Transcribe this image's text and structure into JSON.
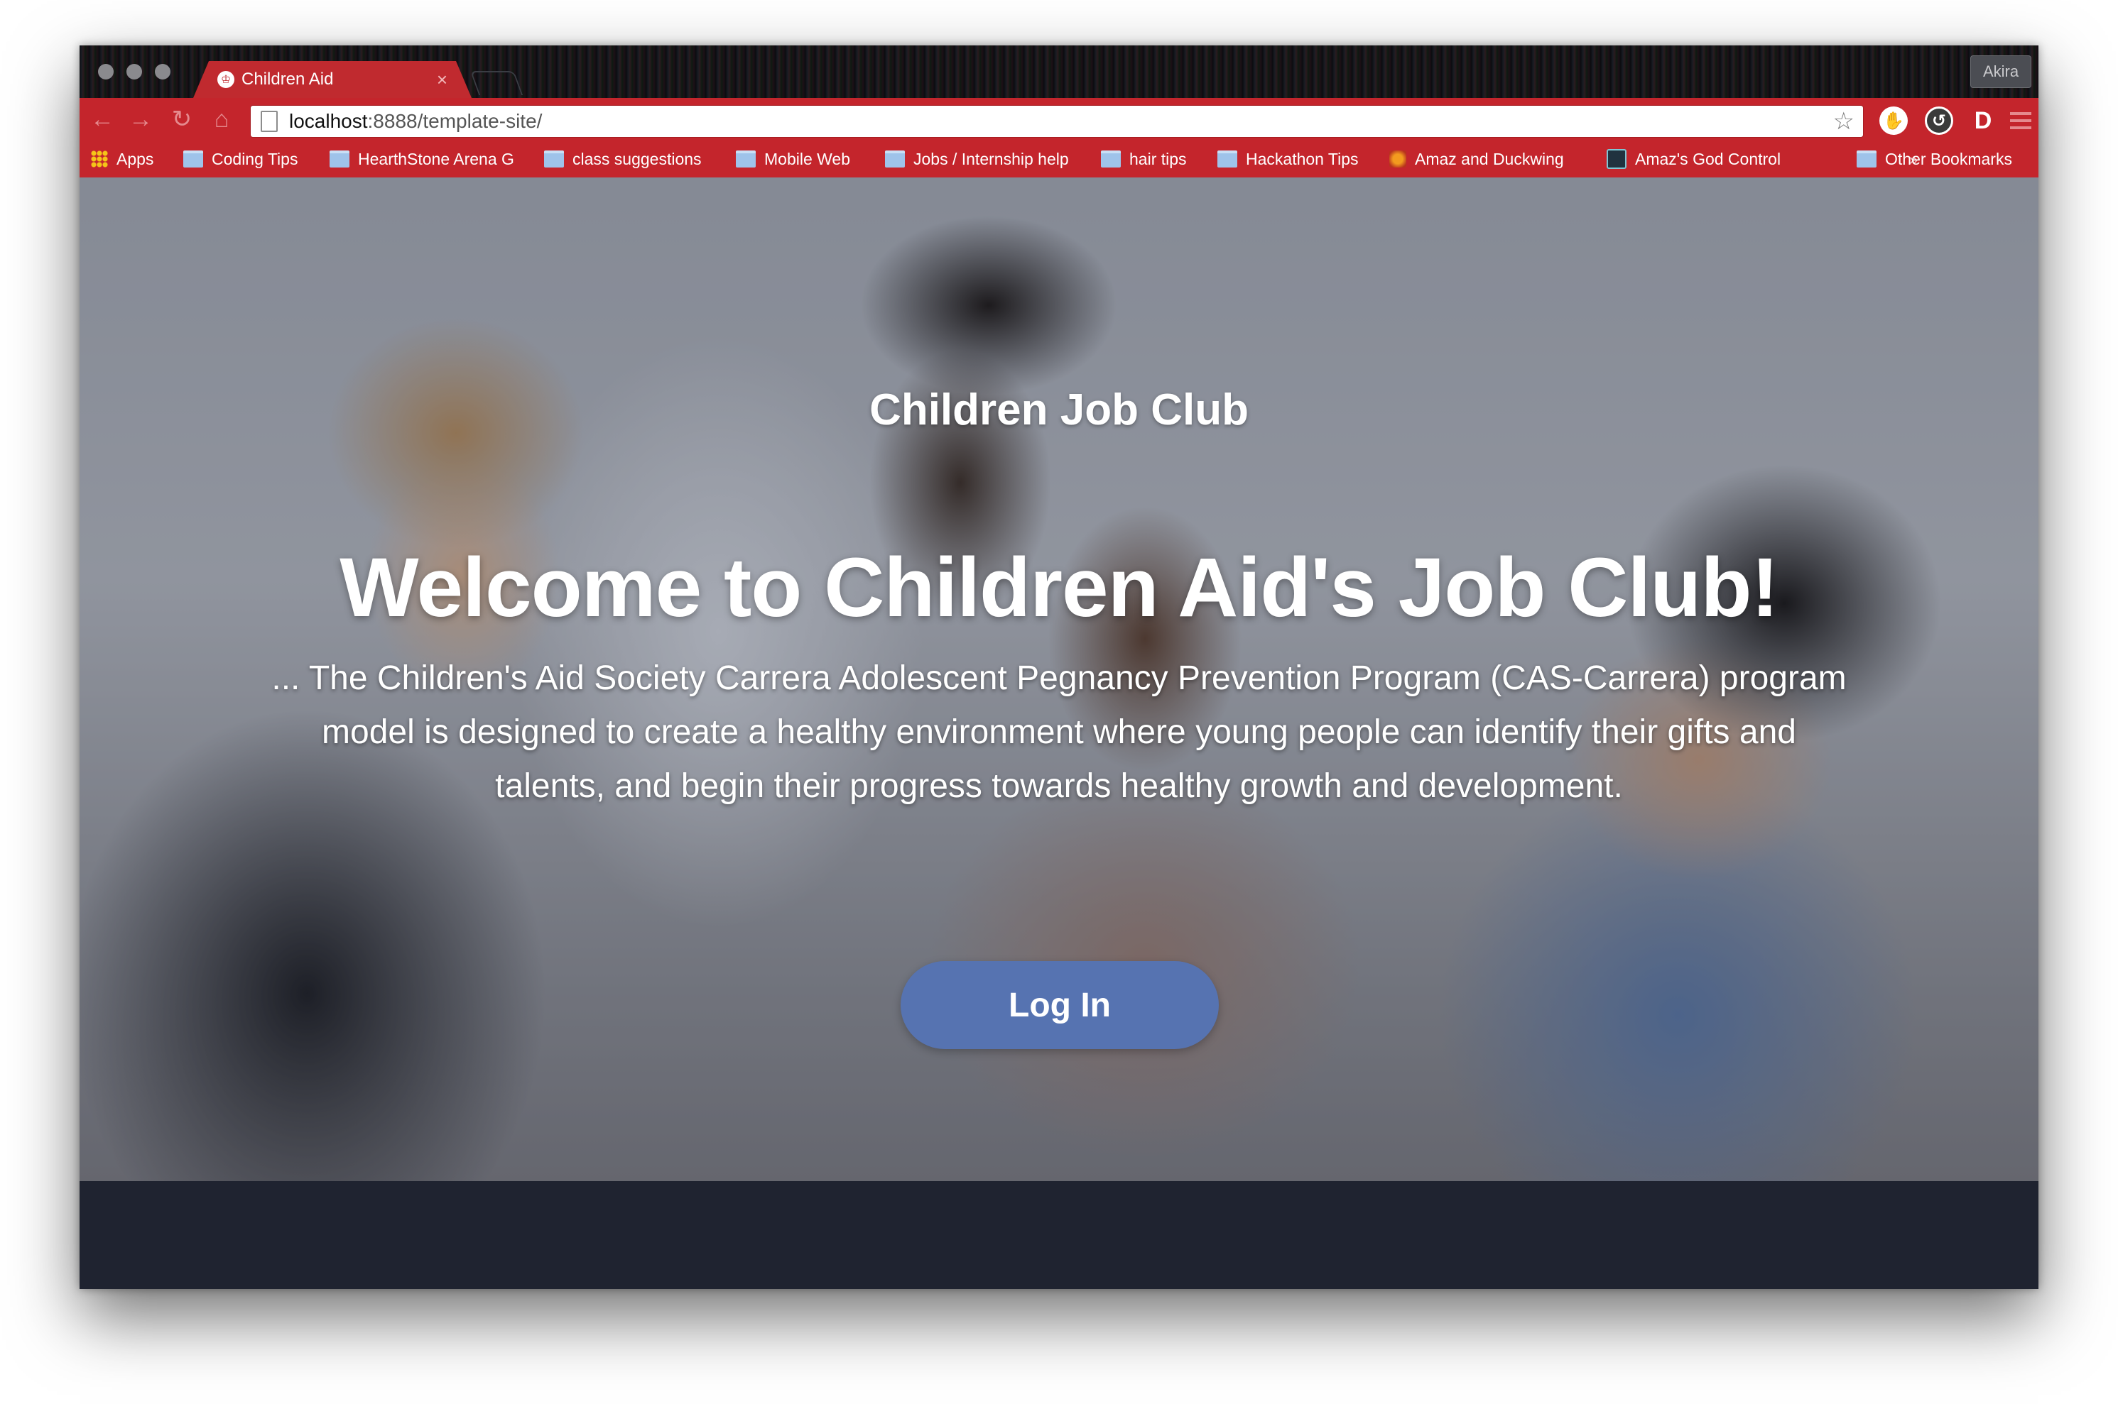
{
  "browser": {
    "profile_name": "Akira",
    "tab": {
      "title": "Children Aid",
      "close_glyph": "×"
    },
    "toolbar": {
      "url_host": "localhost",
      "url_rest": ":8888/template-site/"
    },
    "bookmarks": [
      {
        "label": "Apps",
        "icon": "apps-grid-icon"
      },
      {
        "label": "Coding Tips",
        "icon": "folder-icon"
      },
      {
        "label": "HearthStone Arena G",
        "icon": "folder-icon"
      },
      {
        "label": "class suggestions",
        "icon": "folder-icon"
      },
      {
        "label": "Mobile Web",
        "icon": "folder-icon"
      },
      {
        "label": "Jobs / Internship help",
        "icon": "folder-icon"
      },
      {
        "label": "hair tips",
        "icon": "folder-icon"
      },
      {
        "label": "Hackathon Tips",
        "icon": "folder-icon"
      },
      {
        "label": "Amaz and Duckwing",
        "icon": "favicon-orange"
      },
      {
        "label": "Amaz's God Control",
        "icon": "favicon-blue"
      },
      {
        "label": "Other Bookmarks",
        "icon": "folder-icon"
      }
    ],
    "overflow_chevron": "»"
  },
  "page": {
    "site_title": "Children Job Club",
    "headline": "Welcome to Children Aid's Job Club!",
    "intro": "... The Children's Aid Society Carrera Adolescent Pegnancy Prevention Program (CAS-Carrera) program model is designed to create a healthy environment where young people can identify their gifts and talents, and begin their progress towards healthy growth and development.",
    "login_label": "Log In"
  },
  "colors": {
    "browser_accent": "#c4252c",
    "login_button": "#5673b1",
    "footer": "#1f2330"
  }
}
